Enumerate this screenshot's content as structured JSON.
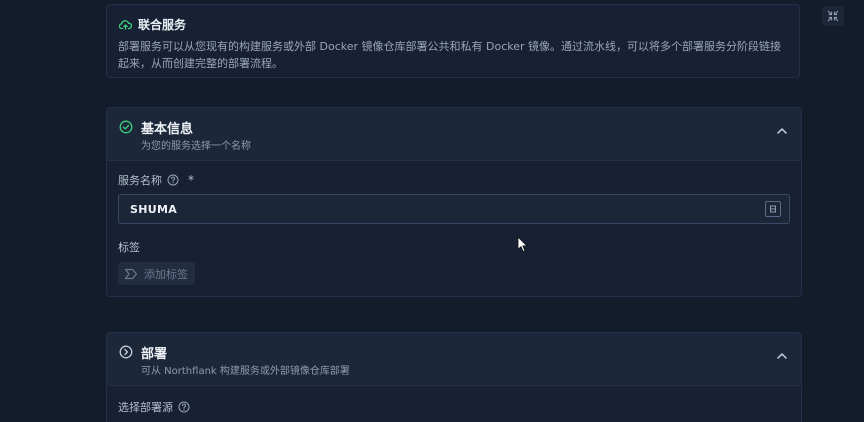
{
  "intro": {
    "title": "联合服务",
    "description": "部署服务可以从您现有的构建服务或外部 Docker 镜像仓库部署公共和私有 Docker 镜像。通过流水线，可以将多个部署服务分阶段链接起来，从而创建完整的部署流程。",
    "icon": "cloud-upload-icon"
  },
  "basic_info": {
    "title": "基本信息",
    "subtitle": "为您的服务选择一个名称",
    "status": "complete",
    "service_name_label": "服务名称",
    "required_mark": "*",
    "service_name_value": "SHUMA",
    "tags_label": "标签",
    "add_tag_label": "添加标签"
  },
  "deploy": {
    "title": "部署",
    "subtitle": "可从 Northflank 构建服务或外部镜像仓库部署",
    "source_label": "选择部署源"
  },
  "colors": {
    "background": "#131c2b",
    "card": "#172133",
    "accent_green": "#3fcf7f"
  }
}
